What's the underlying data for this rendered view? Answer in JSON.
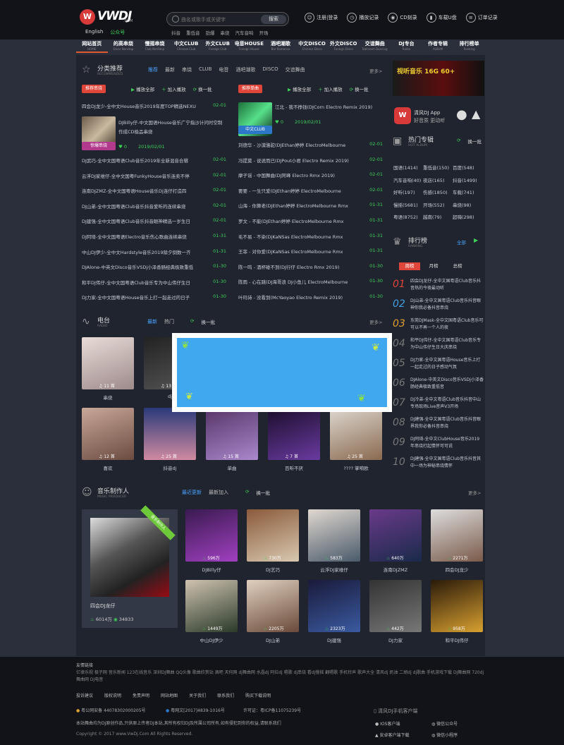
{
  "header": {
    "logo_badge": "W",
    "logo_text": "VWDJ",
    "logo_sub": ".COM",
    "langs": [
      "English",
      "公众号"
    ],
    "search_placeholder": "曲名或歌手或关键字",
    "search_button": "搜索",
    "hotwords": [
      "抖音",
      "重低音",
      "劲爆",
      "串烧",
      "汽车音响",
      "开场"
    ],
    "links": [
      {
        "icon": "user-icon",
        "label": "注册|登录"
      },
      {
        "icon": "history-icon",
        "label": "播放记录"
      },
      {
        "icon": "cd-icon",
        "label": "CD刻录"
      },
      {
        "icon": "usb-icon",
        "label": "车载U盘"
      },
      {
        "icon": "order-icon",
        "label": "订单记录"
      }
    ]
  },
  "nav": [
    {
      "zh": "网站首页",
      "en": "HOME"
    },
    {
      "zh": "的高串烧",
      "en": "Disco Nonstop"
    },
    {
      "zh": "慢摇串烧",
      "en": "Club NonStop"
    },
    {
      "zh": "中文CLUB",
      "en": "Chinese Club"
    },
    {
      "zh": "外文CLUB",
      "en": "Foreign Club"
    },
    {
      "zh": "电音HOUSE",
      "en": "Foreign House"
    },
    {
      "zh": "酒吧潮歌",
      "en": "Bar Romance"
    },
    {
      "zh": "中文DISCO",
      "en": "Chinese Disco"
    },
    {
      "zh": "外文DISCO",
      "en": "Foreign Disco"
    },
    {
      "zh": "交谊舞曲",
      "en": "Ballroom Dancing"
    },
    {
      "zh": "DJ专台",
      "en": "Radio"
    },
    {
      "zh": "作者专辑",
      "en": "ALBUM"
    },
    {
      "zh": "排行榜单",
      "en": "Ranking"
    }
  ],
  "recommend": {
    "title": "分类推荐",
    "en": "RECOMMENDED",
    "tabs": [
      "推荐",
      "最新",
      "串烧",
      "CLUB",
      "电音",
      "酒吧潮歌",
      "DISCO",
      "交谊舞曲"
    ],
    "more": "更多>",
    "left": {
      "tag": "推荐串烧",
      "play": "播放全部",
      "add": "加入播放",
      "refresh": "换一批",
      "top": {
        "title": "四会DJ龙少-全中文House音乐2019年度TOP精选NEXU",
        "date": "02-01"
      },
      "feature": {
        "title": "DJBilly仔-中文国语House音乐广宁指沙计问时空制作成CD极品串烧",
        "badge": "惊爆串烧",
        "count": "0",
        "date": "2019/02/01"
      },
      "list": [
        {
          "t": "DJ武巧-全中文国粤语Club音乐2019年全新混音合辑",
          "d": "02-01"
        },
        {
          "t": "云浮DJ家维仔-全中文国粤FunkyHouse音乐连卖不停",
          "d": "02-01"
        },
        {
          "t": "连南DJZMZ-全中文国粤语House音乐Dj连仔打造四",
          "d": "02-01"
        },
        {
          "t": "DJ山弟-全中文国粤语Club音乐抖音爱听的连续串烧",
          "d": "02-01"
        },
        {
          "t": "DJ建强-全中文国粤语Club音乐抖音眼神精选一岁生日",
          "d": "02-01"
        },
        {
          "t": "DJ阿琦-全中文国粤语Electro音乐伤心歌曲连续串烧",
          "d": "01-31"
        },
        {
          "t": "中山DJ伊少-全中文Hardstyle音乐2019除夕倒数一齐",
          "d": "01-31"
        },
        {
          "t": "DJAlone-中英文Disco音乐VSDj小泽香肠经典极致重低",
          "d": "01-30"
        },
        {
          "t": "和平DJ伟仔-全中文国粤语Club音乐专为中山伟仔生日",
          "d": "01-30"
        },
        {
          "t": "DJ力家-全中文国粤语House音乐上打一起走过的日子",
          "d": "01-30"
        }
      ]
    },
    "right": {
      "tag": "推荐单曲",
      "play": "播放全部",
      "add": "加入播放",
      "refresh": "换一批",
      "feature": {
        "title": "江北 - 我不挣钱(DJCorn Electro Remix 2019)",
        "badge": "中文CLUB",
        "count": "0",
        "date": "2019/02/01"
      },
      "list": [
        {
          "t": "刘德华 - 沙漠骆驼(DJEthan婷婷 ElectroMelbourne",
          "d": "02-01"
        },
        {
          "t": "冯提莫 - 说说而已(DJPout小君 Electro Remix 2019)",
          "d": "02-01"
        },
        {
          "t": "摩子谣 - 中国舞曲(DJ阿峰 Electro Rmx 2019)",
          "d": "02-01"
        },
        {
          "t": "要要 - 一生只爱(DJEthan婷婷 ElectroMelbourne",
          "d": "02-01"
        },
        {
          "t": "山海 - 你算老(DJEthan婷婷 ElectroMelbourne Rmx",
          "d": "01-31"
        },
        {
          "t": "罗文 - 不能(DJEthan婷婷 ElectroMelbourne Rmx",
          "d": "01-31"
        },
        {
          "t": "毛不易 - 不染(DjKaNSas ElectroMelbourne Rmx",
          "d": "01-31"
        },
        {
          "t": "王菲 - 对你爱(DjKaNSas ElectroMelbourne Rmx",
          "d": "01-31"
        },
        {
          "t": "陈一鸣 - 酒杯碰不到(DJ行仔 Electro Rmx 2019)",
          "d": "01-30"
        },
        {
          "t": "陈雨 - 心在跳(DJ海哥浪 DJ小鱼儿 ElectroMelbourne",
          "d": "01-30"
        },
        {
          "t": "叶玛诗 - 没看到(McYaoyao Electro Remix 2019)",
          "d": "01-30"
        }
      ]
    }
  },
  "radio": {
    "title": "电台",
    "en": "RADIO",
    "tabs": [
      "最新",
      "热门"
    ],
    "refresh": "换一批",
    "more": "更多>",
    "items": [
      {
        "name": "串烧",
        "count": "11 首"
      },
      {
        "name": "dj",
        "count": "13 首"
      },
      {
        "name": "",
        "count": ""
      },
      {
        "name": "",
        "count": ""
      },
      {
        "name": "",
        "count": ""
      },
      {
        "name": "喜欢",
        "count": "12 首"
      },
      {
        "name": "抖音dj",
        "count": "25 首"
      },
      {
        "name": "单曲",
        "count": "15 首"
      },
      {
        "name": "百听不厌",
        "count": "7 首"
      },
      {
        "name": "???? 掌嗬欧",
        "count": "25 首"
      }
    ]
  },
  "producer": {
    "title": "音乐制作人",
    "en": "MUSIC PRODUCER",
    "tabs": [
      "最近更新",
      "最新加入"
    ],
    "refresh": "换一批",
    "more": "更多>",
    "featured": {
      "ribbon": "音乐制作人",
      "name": "四会DJ龙仔",
      "plays": "6014万",
      "fans": "34833"
    },
    "items": [
      {
        "name": "DJBilly仔",
        "plays": "596万"
      },
      {
        "name": "DJ艺巧",
        "plays": "730万"
      },
      {
        "name": "云浮DJ家维仔",
        "plays": "583万"
      },
      {
        "name": "连南DJZMZ",
        "plays": "640万"
      },
      {
        "name": "四会DJ龙少",
        "plays": "2271万"
      },
      {
        "name": "中山DJ伊少",
        "plays": "1449万"
      },
      {
        "name": "DJ山弟",
        "plays": "2205万"
      },
      {
        "name": "DJ建强",
        "plays": "2323万"
      },
      {
        "name": "DJ力家",
        "plays": "442万"
      },
      {
        "name": "和平DJ伟仔",
        "plays": "958万"
      }
    ]
  },
  "sidebar": {
    "ad_text": "视听音乐 16G 60+",
    "app_title": "清风DJ App",
    "app_sub": "好音质 更动听",
    "album_title": "热门专辑",
    "album_en": "HOT ALBUM",
    "album_refresh": "换一批",
    "albums": [
      [
        "国语(1414)",
        "重低音(150)",
        "百度(548)"
      ],
      [
        "汽车音响(40)",
        "夜店(165)",
        "抖音(1499)"
      ],
      [
        "好听(197)",
        "伤感(1850)",
        "车载(741)"
      ],
      [
        "慢摇(5681)",
        "开场(552)",
        "串烧(98)"
      ],
      [
        "粤语(8752)",
        "越南(79)",
        "超嗨(298)"
      ]
    ],
    "rank_title": "排行榜",
    "rank_en": "RANKING",
    "rank_more": "全部",
    "rank_tabs": [
      "周榜",
      "月榜",
      "总榜"
    ],
    "ranks": [
      {
        "n": "01",
        "t": "四会DJ龙仔-全中文国粤语Club音乐抖音热的今夜最动听"
      },
      {
        "n": "02",
        "t": "DJ山弟-全中文国粤语Club音乐抖音眼神你我必备抖音串烧"
      },
      {
        "n": "03",
        "t": "东莞DJMask-全中文国粤语Club音乐可可以不再一个人的夜"
      },
      {
        "n": "04",
        "t": "和平DJ伟仔-全中文国粤语Club音乐专为中山伟仔生日大庆串烧"
      },
      {
        "n": "05",
        "t": "DJ力家-全中文国粤语House音乐上打一起走过的日子感动气氛"
      },
      {
        "n": "06",
        "t": "DJAlone-中英文Disco音乐VSDj小泽香肠经典极致重低音"
      },
      {
        "n": "07",
        "t": "DJ冷弟-全中文粤语Club音乐抖音中山专场现场Live音声V3开场"
      },
      {
        "n": "08",
        "t": "DJ建强-全中文国粤语Club音乐抖音眼界我你必备抖音串烧"
      },
      {
        "n": "09",
        "t": "DJ阿琦-全中文ClubHouse音乐2019年串烧打起情怀可可说"
      },
      {
        "n": "10",
        "t": "DJ建强-全中文国粤语Club音乐抖音其中一场为神秘串烧情怀"
      }
    ]
  },
  "footer": {
    "links_title": "友情链接",
    "links": "亿律乐视 极子网 音乐新闻 123在线音乐 深圳DJ舞曲 QQ头像 歌曲欣赏站 酒吧 天何网 dj舞曲网 水晶dj 阿拉dj 唱歌 dj串烧 看dj慢摇 翻唱歌 手机铃声 歌声大全 清风dj 奶油 二胡dj dj歌曲 手机游戏下载 DJ舞曲网 720dj舞曲网 DJ电音",
    "nav": [
      "投诉建议",
      "版权说明",
      "免责声明",
      "网站地图",
      "关于我们",
      "联系我们",
      "购买下载说明"
    ],
    "license1": "粤公网安备 44078302000205号",
    "license2": "粤网文[2017]4839-1016号",
    "license3": "许可证：粤ICP备11075239号",
    "notice": "本站舞曲均为DJ原创作品,只供原上传者DJ本站,其所有权归DJ及所属公司所有,如有侵犯到你的权益,请联系我们",
    "copyright": "Copyright © 2017 www.VwDj.Com All Rights Reserved.",
    "client_title": "清风DJ手机客户端",
    "clients": [
      "IOS客户端",
      "微信公众号",
      "安卓客户端下载",
      "微信小程序"
    ]
  }
}
